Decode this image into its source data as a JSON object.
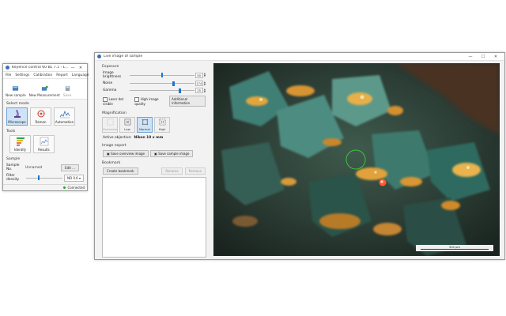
{
  "control_window": {
    "title": "Keyence control 60 BL 7.1 - L...",
    "controls": {
      "minimize": "—",
      "maximize": "☐",
      "close": "✕"
    },
    "menu": [
      "File",
      "Settings",
      "Calibration",
      "Report",
      "Language"
    ],
    "toolbar": {
      "new_sample": "New sample",
      "new_measurement": "New Measurement",
      "save": "Save"
    },
    "select_mode": {
      "heading": "Select mode",
      "modes": [
        {
          "label": "Microscope",
          "icon": "microscope-icon"
        },
        {
          "label": "Raman",
          "icon": "raman-icon"
        },
        {
          "label": "Automation",
          "icon": "automation-icon"
        }
      ]
    },
    "tools": {
      "heading": "Tools",
      "items": [
        {
          "label": "Identify",
          "icon": "identify-icon"
        },
        {
          "label": "Results",
          "icon": "results-icon"
        }
      ]
    },
    "sample": {
      "heading": "Sample",
      "sample_no_label": "Sample No.",
      "sample_no_value": "Unnamed",
      "edit_label": "Edit ...",
      "filter_density_label": "Filter density",
      "filter_density_value": "ND 0.6",
      "filter_density_level": 0.35
    },
    "status": {
      "text": "Connected",
      "color": "#21a421"
    }
  },
  "live_window": {
    "title": "Live image of sample",
    "controls": {
      "minimize": "—",
      "maximize": "☐",
      "close": "✕"
    },
    "exposure": {
      "heading": "Exposure",
      "brightness_label": "Image brightness",
      "brightness_value": "50",
      "brightness_level": 0.5,
      "noise_label": "Noise",
      "noise_value": "174",
      "noise_level": 0.68,
      "gamma_label": "Gamma",
      "gamma_value": "25",
      "gamma_level": 0.78,
      "laser_dot_label": "Laser dot visible",
      "high_quality_label": "High image quality",
      "additional_label": "Additional information"
    },
    "magnification": {
      "heading": "Magnification",
      "buttons": [
        {
          "label": "Overview",
          "state": "disabled"
        },
        {
          "label": "Low",
          "state": "normal"
        },
        {
          "label": "Normal",
          "state": "active"
        },
        {
          "label": "High",
          "state": "normal"
        }
      ],
      "objective_label": "Active objective:",
      "objective_value": "Nikon 10 x mm"
    },
    "image_export": {
      "heading": "Image export",
      "save_overview": "Save overview image",
      "save_sample": "Save sample image"
    },
    "bookmark": {
      "heading": "Bookmark",
      "create": "Create bookmark",
      "rename": "Rename",
      "remove": "Remove"
    },
    "scalebar_label": "500 μm"
  }
}
